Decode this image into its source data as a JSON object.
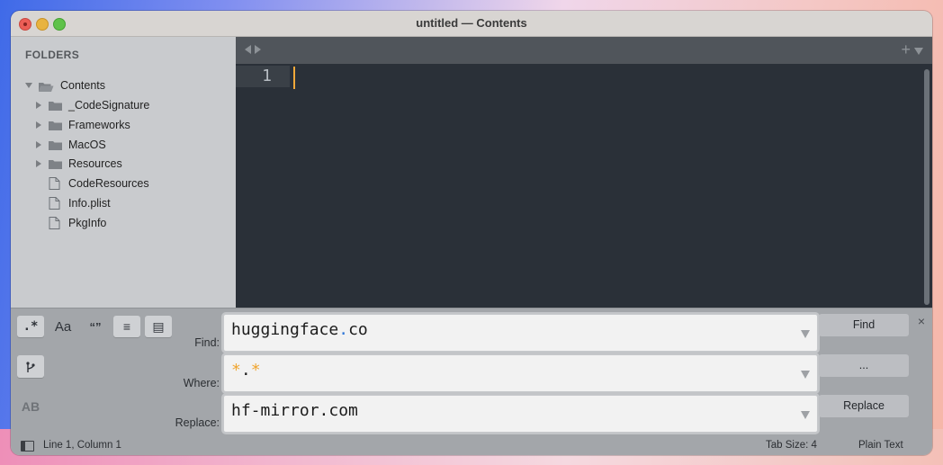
{
  "window": {
    "title": "untitled — Contents"
  },
  "sidebar": {
    "heading": "FOLDERS",
    "root": "Contents",
    "items": [
      {
        "label": "_CodeSignature",
        "kind": "folder"
      },
      {
        "label": "Frameworks",
        "kind": "folder"
      },
      {
        "label": "MacOS",
        "kind": "folder"
      },
      {
        "label": "Resources",
        "kind": "folder"
      },
      {
        "label": "CodeResources",
        "kind": "file"
      },
      {
        "label": "Info.plist",
        "kind": "file"
      },
      {
        "label": "PkgInfo",
        "kind": "file"
      }
    ]
  },
  "editor": {
    "line_number": "1",
    "tab_plus": "+"
  },
  "find_panel": {
    "options": {
      "regex": ".*",
      "case": "Aa",
      "whole_word": "“”",
      "in_selection": "≡",
      "highlight": "▤",
      "preserve_case": "AB"
    },
    "find_label": "Find:",
    "where_label": "Where:",
    "replace_label": "Replace:",
    "find_value_a": "huggingface",
    "find_value_b": ".",
    "find_value_c": "co",
    "where_value_a": "*",
    "where_value_b": ".",
    "where_value_c": "*",
    "replace_value": "hf-mirror.com",
    "find_button": "Find",
    "where_button": "...",
    "replace_button": "Replace",
    "close": "×"
  },
  "status": {
    "position": "Line 1, Column 1",
    "tab_size": "Tab Size: 4",
    "syntax": "Plain Text"
  },
  "colors": {
    "editor_bg": "#2a3038",
    "caret": "#f0a83a",
    "sidebar_bg": "#c9cbce",
    "panel_bg": "#a3a6aa"
  }
}
